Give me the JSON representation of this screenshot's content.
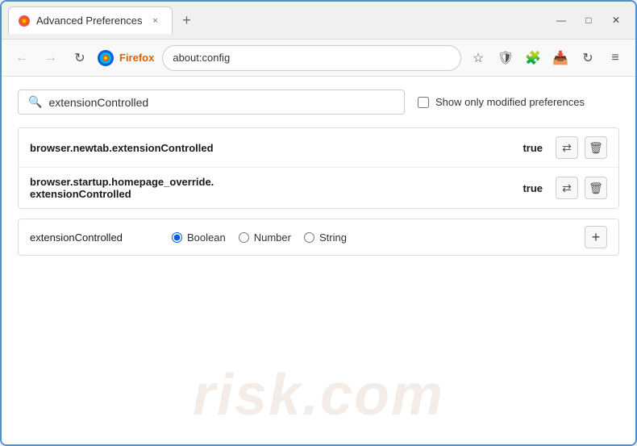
{
  "window": {
    "title": "Advanced Preferences",
    "tab_close": "×",
    "new_tab": "+",
    "minimize": "—",
    "maximize": "□",
    "close": "✕"
  },
  "navbar": {
    "back_title": "Back",
    "forward_title": "Forward",
    "reload_title": "Reload",
    "firefox_label": "Firefox",
    "url": "about:config",
    "bookmark_icon": "☆",
    "shield_icon": "🛡",
    "extension_icon": "🧩",
    "download_icon": "⬇",
    "sync_icon": "↻",
    "menu_icon": "≡"
  },
  "search": {
    "value": "extensionControlled",
    "placeholder": "Search preference name",
    "show_modified_label": "Show only modified preferences"
  },
  "results": [
    {
      "name": "browser.newtab.extensionControlled",
      "value": "true"
    },
    {
      "name": "browser.startup.homepage_override.\nextensionControlled",
      "name_line1": "browser.startup.homepage_override.",
      "name_line2": "extensionControlled",
      "value": "true",
      "multiline": true
    }
  ],
  "new_pref": {
    "name": "extensionControlled",
    "types": [
      "Boolean",
      "Number",
      "String"
    ],
    "selected_type": "Boolean",
    "add_label": "+"
  },
  "watermark": {
    "text": "risk.com"
  }
}
